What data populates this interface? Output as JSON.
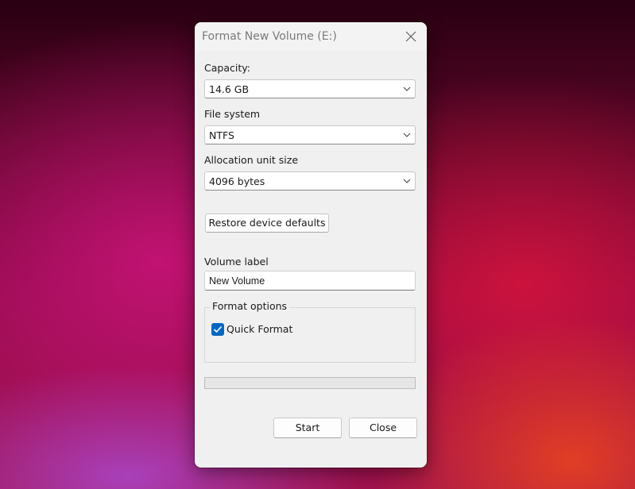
{
  "dialog": {
    "title": "Format New Volume (E:)",
    "capacity": {
      "label": "Capacity:",
      "value": "14.6 GB"
    },
    "file_system": {
      "label": "File system",
      "value": "NTFS"
    },
    "allocation": {
      "label": "Allocation unit size",
      "value": "4096 bytes"
    },
    "restore_label": "Restore device defaults",
    "volume_label": {
      "label": "Volume label",
      "value": "New Volume"
    },
    "format_options": {
      "legend": "Format options",
      "quick_format_label": "Quick Format",
      "quick_format_checked": true
    },
    "progress_fraction": 0,
    "start_label": "Start",
    "close_label": "Close"
  },
  "colors": {
    "accent": "#0067c0",
    "dialog_bg": "#f0f0f0"
  },
  "icons": {
    "close": "close-icon",
    "dropdown": "chevron-down-icon",
    "check": "checkmark-icon"
  }
}
